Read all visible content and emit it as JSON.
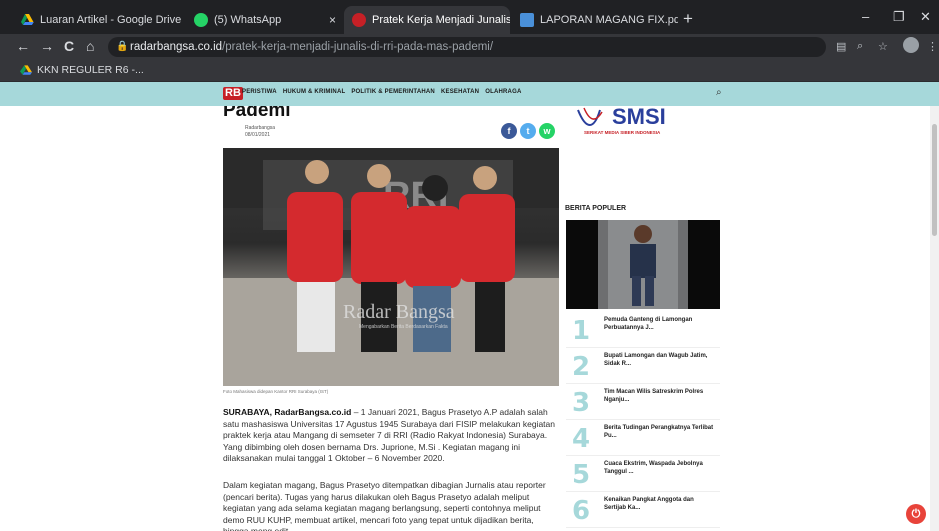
{
  "browser": {
    "tabs": [
      {
        "label": "Luaran Artikel - Google Drive",
        "close": "×"
      },
      {
        "label": "(5) WhatsApp",
        "close": "×"
      },
      {
        "label": "Pratek Kerja Menjadi Junalis di RI",
        "close": "×"
      },
      {
        "label": "LAPORAN MAGANG FIX.pdf",
        "close": "×"
      }
    ],
    "new_tab": "+",
    "window_controls": {
      "minimize": "–",
      "restore": "❐",
      "close": "✕"
    },
    "nav": {
      "back": "←",
      "forward": "→",
      "reload": "C",
      "home": "⌂"
    },
    "url_domain": "radarbangsa.co.id",
    "url_path": "/pratek-kerja-menjadi-junalis-di-rri-pada-mas-pademi/",
    "bookmark": "KKN REGULER R6 -..."
  },
  "site": {
    "logo": "RB",
    "menu": [
      "PERISTIWA",
      "HUKUM & KRIMINAL",
      "POLITIK & PEMERINTAHAN",
      "KESEHATAN",
      "OLAHRAGA"
    ],
    "search_icon": "⌕"
  },
  "article": {
    "title_fragment": "Pademi",
    "author": "Radarbangsa",
    "date": "08/01/2021",
    "share": {
      "facebook": "f",
      "twitter": "t",
      "whatsapp": "w"
    },
    "photo_watermark": "Radar Bangsa",
    "photo_watermark_sub": "Mengabarkan Berita Berdasarkan Fakta",
    "photo_banner": "RRI",
    "caption": "Foto Mahasiswa didepan Kantor RRI Surabaya (IST)",
    "p1_lead": "SURABAYA, RadarBangsa.co.id",
    "p1_rest": " – 1 Januari 2021, Bagus Prasetyo A.P adalah salah satu mashasiswa Universitas 17 Agustus 1945 Surabaya dari FISIP melakukan kegiatan praktek kerja atau Mangang di semseter 7 di RRI (Radio Rakyat Indonesia) Surabaya. Yang dibimbing oleh dosen bernama Drs. Juprione, M.Si . Kegiatan magang ini dilaksanakan mulai tanggal 1 Oktober – 6 November 2020.",
    "p2": "Dalam kegiatan magang, Bagus Prasetyo ditempatkan dibagian Jurnalis atau reporter (pencari berita). Tugas yang harus dilakukan oleh Bagus Prasetyo adalah meliput kegiatan yang ada selama kegiatan magang berlangsung, seperti contohnya meliput demo RUU KUHP, membuat artikel, mencari foto yang tepat untuk dijadikan berita, hingga meng edit"
  },
  "sidebar": {
    "smsi_text": "SMSI",
    "smsi_sub": "SERIKAT MEDIA SIBER INDONESIA",
    "popular_title": "BERITA POPULER",
    "popular": [
      {
        "num": "1",
        "title": "Pemuda Ganteng di Lamongan Perbuatannya J..."
      },
      {
        "num": "2",
        "title": "Bupati Lamongan dan Wagub Jatim, Sidak R..."
      },
      {
        "num": "3",
        "title": "Tim Macan Wilis Satreskrim Polres Nganju..."
      },
      {
        "num": "4",
        "title": "Berita Tudingan Perangkatnya Terlibat Pu..."
      },
      {
        "num": "5",
        "title": "Cuaca Ekstrim, Waspada Jebolnya Tanggul ..."
      },
      {
        "num": "6",
        "title": "Kenaikan Pangkat Anggota dan Sertijab Ka..."
      }
    ]
  },
  "colors": {
    "accent": "#a6d8da",
    "brand_red": "#c62026",
    "facebook": "#3b5998",
    "twitter": "#55acee",
    "whatsapp": "#25d366"
  }
}
